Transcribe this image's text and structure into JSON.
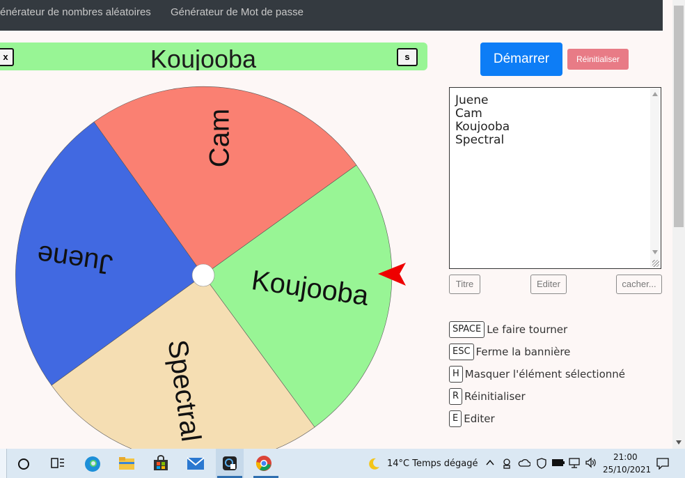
{
  "nav": {
    "links": [
      "énérateur de nombres aléatoires",
      "Générateur de Mot de passe"
    ]
  },
  "banner": {
    "title": "Koujooba",
    "close_label": "x",
    "save_label": "s",
    "color": "#98f595"
  },
  "wheel": {
    "segments": [
      {
        "label": "Cam",
        "color": "#fa8072"
      },
      {
        "label": "Koujooba",
        "color": "#98f595"
      },
      {
        "label": "Spectral",
        "color": "#f5deb3"
      },
      {
        "label": "Juene",
        "color": "#4169e1"
      }
    ],
    "pointer_color": "#ee0000"
  },
  "controls": {
    "start_label": "Démarrer",
    "reset_label": "Réinitialiser",
    "names": [
      "Juene",
      "Cam",
      "Koujooba",
      "Spectral"
    ],
    "title_label": "Titre",
    "edit_label": "Editer",
    "hide_label": "cacher..."
  },
  "shortcuts": [
    {
      "key": "SPACE",
      "label": "Le faire tourner"
    },
    {
      "key": "ESC",
      "label": "Ferme la bannière"
    },
    {
      "key": "H",
      "label": "Masquer l'élément sélectionné"
    },
    {
      "key": "R",
      "label": "Réinitialiser"
    },
    {
      "key": "E",
      "label": "Editer"
    }
  ],
  "taskbar": {
    "weather": "14°C  Temps dégagé",
    "time": "21:00",
    "date": "25/10/2021"
  }
}
